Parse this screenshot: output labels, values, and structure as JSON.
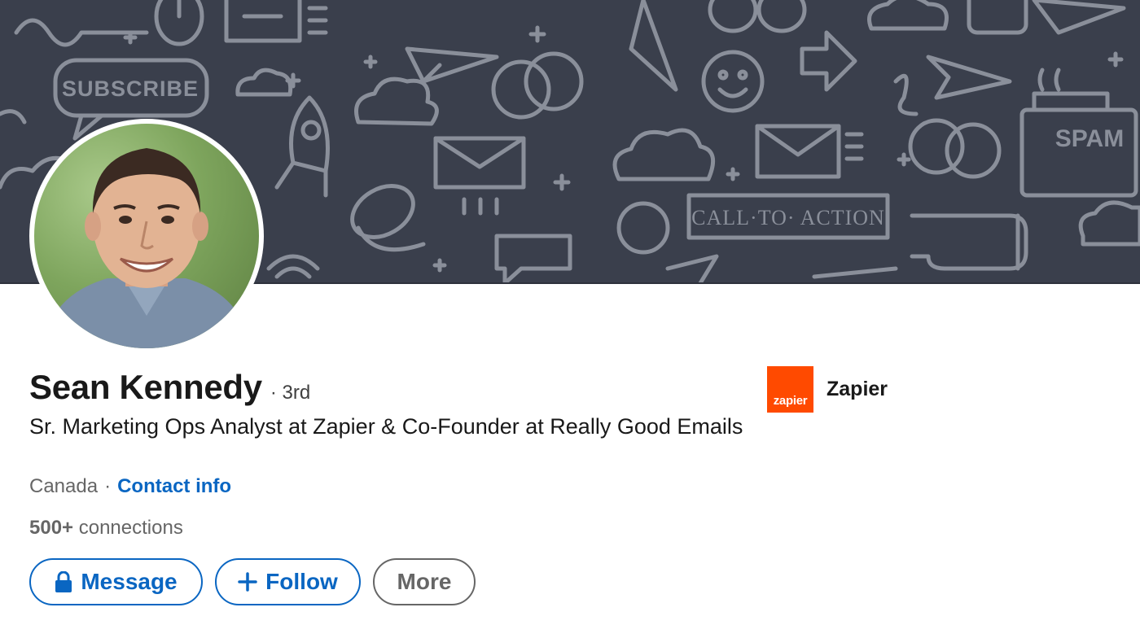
{
  "profile": {
    "name": "Sean Kennedy",
    "degree": "· 3rd",
    "headline": "Sr. Marketing Ops Analyst at Zapier & Co-Founder at Really Good Emails",
    "location": "Canada",
    "location_separator": "·",
    "contact_info": "Contact info",
    "connections_count": "500+",
    "connections_label": "connections"
  },
  "banner": {
    "subscribe_label": "SUBSCRIBE",
    "cta_label": "CALL·TO· ACTION",
    "spam_label": "SPAM"
  },
  "company": {
    "logo_text": "zapier",
    "name": "Zapier"
  },
  "actions": {
    "message_label": "Message",
    "follow_label": "Follow",
    "more_label": "More"
  },
  "colors": {
    "accent": "#0a66c2",
    "banner_bg": "#3a3f4c",
    "zapier_orange": "#ff4a00"
  }
}
